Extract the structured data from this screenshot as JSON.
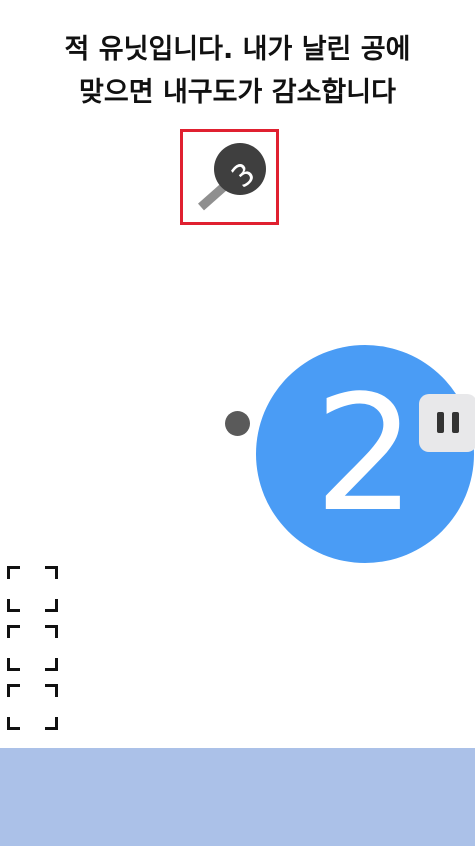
{
  "instruction": {
    "line1": "적 유닛입니다. 내가 날린 공에",
    "line2": "맞으면 내구도가 감소합니다"
  },
  "enemy_unit": {
    "durability": "3",
    "highlight_color": "#e02030",
    "icon": "paddle-icon"
  },
  "player_unit": {
    "number": "2",
    "color": "#4a9cf5"
  },
  "ball": {
    "color": "#5a5a5a"
  },
  "pause_button": {
    "icon": "pause-icon"
  },
  "slots": {
    "count": 3
  },
  "ground": {
    "color": "#abc1e8"
  }
}
